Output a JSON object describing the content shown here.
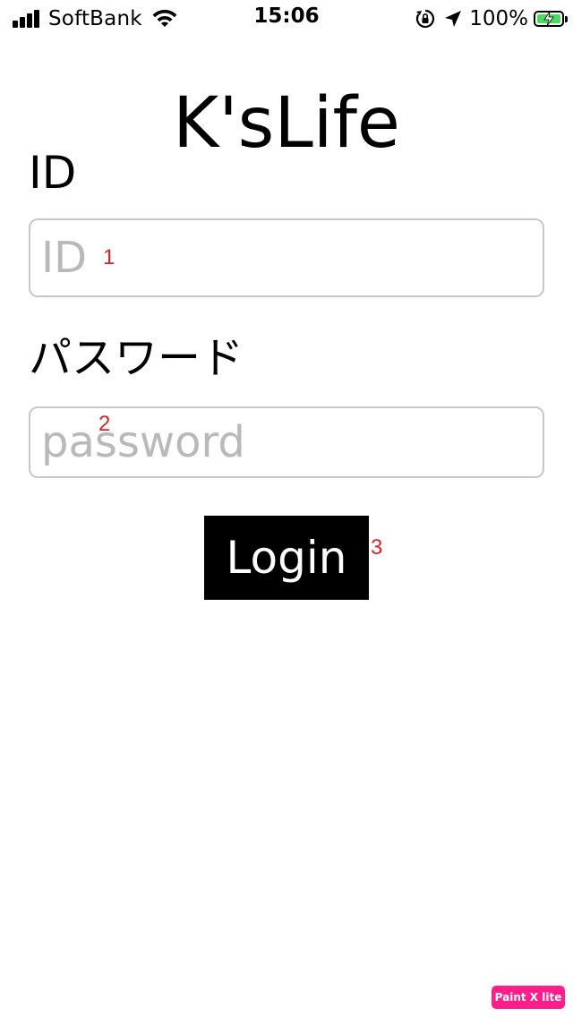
{
  "status_bar": {
    "carrier": "SoftBank",
    "time": "15:06",
    "battery_percent": "100%",
    "battery_level": 1.0,
    "signal_bars": 4,
    "battery_fill_color": "#4cd964",
    "icons": [
      "signal-icon",
      "wifi-icon",
      "orientation-lock-icon",
      "location-arrow-icon",
      "battery-icon",
      "charging-bolt-icon"
    ]
  },
  "app": {
    "title": "K'sLife"
  },
  "form": {
    "id_label": "ID",
    "id_placeholder": "ID",
    "id_value": "",
    "password_label": "パスワード",
    "password_placeholder": "password",
    "password_value": "",
    "login_label": "Login"
  },
  "annotations": {
    "marker_1": "1",
    "marker_2": "2",
    "marker_3": "3",
    "marker_color": "#e32020"
  },
  "watermark": {
    "text": "Paint X lite",
    "color": "#ff1e8c"
  }
}
